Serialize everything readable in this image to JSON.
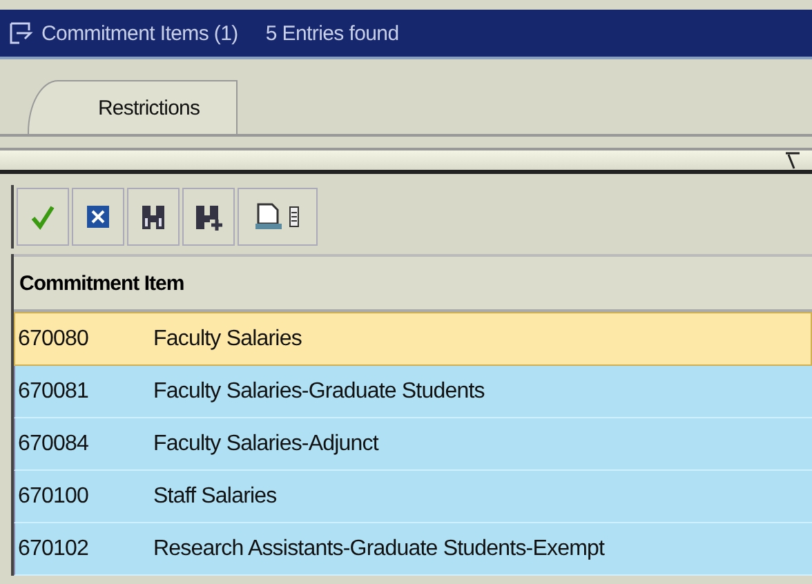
{
  "window": {
    "title": "Commitment Items (1)",
    "status": "5 Entries found"
  },
  "tabs": [
    {
      "label": "Restrictions",
      "selected": true
    }
  ],
  "toolbar": [
    {
      "kind": "check"
    },
    {
      "kind": "cancel"
    },
    {
      "kind": "find"
    },
    {
      "kind": "find-next"
    },
    {
      "kind": "print"
    }
  ],
  "table": {
    "columns": [
      "Commitment Item"
    ],
    "rows": [
      {
        "code": "670080",
        "text": "Faculty Salaries",
        "selected": true
      },
      {
        "code": "670081",
        "text": "Faculty Salaries-Graduate Students",
        "selected": false
      },
      {
        "code": "670084",
        "text": "Faculty Salaries-Adjunct",
        "selected": false
      },
      {
        "code": "670100",
        "text": "Staff Salaries",
        "selected": false
      },
      {
        "code": "670102",
        "text": "Research Assistants-Graduate Students-Exempt",
        "selected": false
      }
    ]
  }
}
